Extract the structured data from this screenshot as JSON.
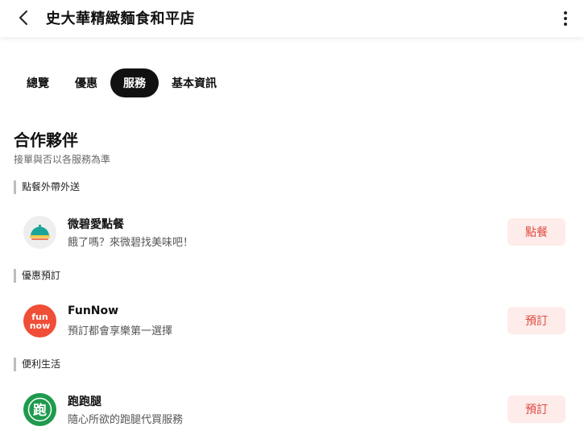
{
  "header": {
    "title": "史大華精緻麵食和平店",
    "back_icon": "chevron-left-icon",
    "more_icon": "more-vertical-icon"
  },
  "tabs": [
    {
      "label": "總覽",
      "active": false
    },
    {
      "label": "優惠",
      "active": false
    },
    {
      "label": "服務",
      "active": true
    },
    {
      "label": "基本資訊",
      "active": false
    }
  ],
  "section": {
    "title": "合作夥伴",
    "subtitle": "接單與否以各服務為準"
  },
  "groups": [
    {
      "heading": "點餐外帶外送",
      "item": {
        "name": "微碧愛點餐",
        "desc": "餓了嗎？來微碧找美味吧！",
        "button": "點餐",
        "logo_icon": "food-cloche-icon"
      }
    },
    {
      "heading": "優惠預訂",
      "item": {
        "name": "FunNow",
        "desc": "預訂都會享樂第一選擇",
        "button": "預訂",
        "logo_icon": "funnow-logo-icon",
        "logo_text_1": "fun",
        "logo_text_2": "now"
      }
    },
    {
      "heading": "便利生活",
      "item": {
        "name": "跑跑腿",
        "desc": "隨心所欲的跑腿代買服務",
        "button": "預訂",
        "logo_icon": "paopaotui-logo-icon",
        "logo_text": "跑"
      }
    }
  ],
  "colors": {
    "accent_text": "#e0493f",
    "accent_bg": "#fdecea",
    "funnow": "#f04e37",
    "paopaotui": "#1f9a4e",
    "cloche_green": "#1aa59a"
  }
}
